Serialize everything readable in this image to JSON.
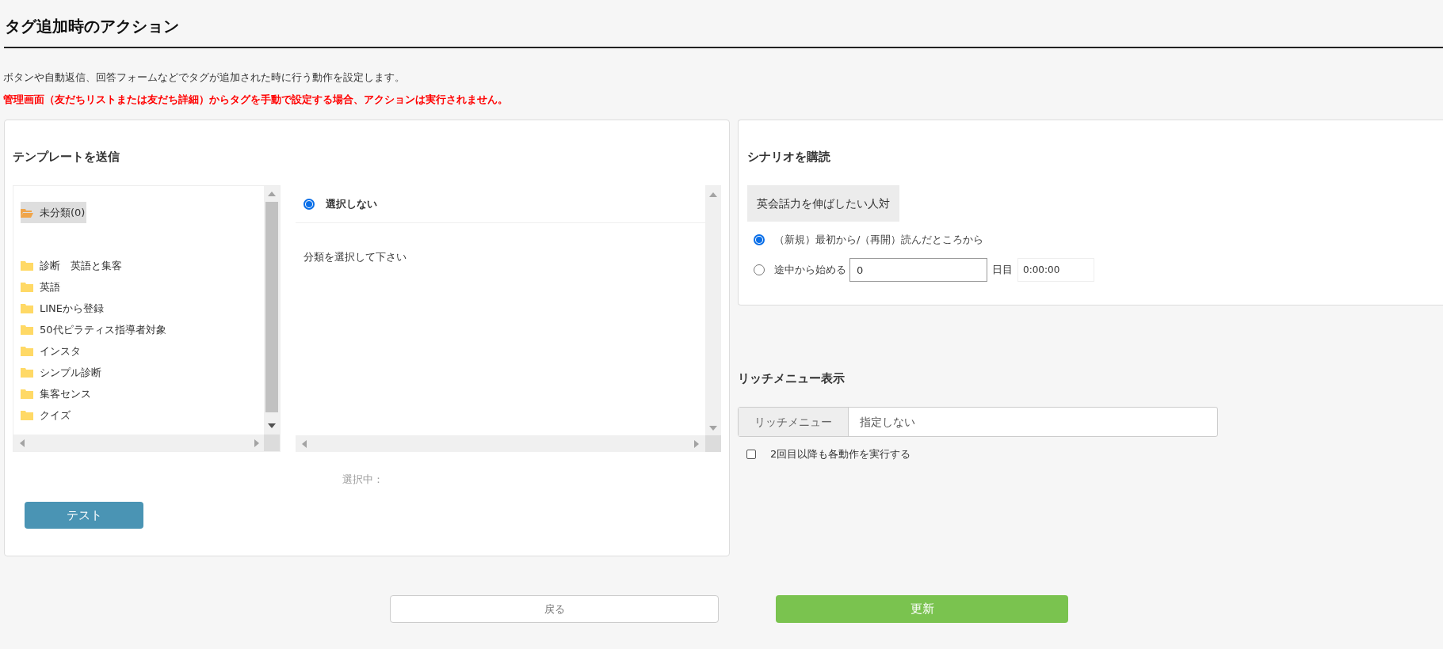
{
  "page_title": "タグ追加時のアクション",
  "description": "ボタンや自動返信、回答フォームなどでタグが追加された時に行う動作を設定します。",
  "warning": "管理画面（友だちリストまたは友だち詳細）からタグを手動で設定する場合、アクションは実行されません。",
  "template_section": {
    "heading": "テンプレートを送信",
    "folders": [
      {
        "name": "未分類(0)",
        "selected": true
      },
      {
        "name": "診断　英語と集客",
        "selected": false
      },
      {
        "name": "英語",
        "selected": false
      },
      {
        "name": "LINEから登録",
        "selected": false
      },
      {
        "name": "50代ピラティス指導者対象",
        "selected": false
      },
      {
        "name": "インスタ",
        "selected": false
      },
      {
        "name": "シンプル診断",
        "selected": false
      },
      {
        "name": "集客センス",
        "selected": false
      },
      {
        "name": "クイズ",
        "selected": false
      }
    ],
    "option": {
      "label": "選択しない",
      "selected": true
    },
    "hint": "分類を選択して下さい",
    "selected_label": "選択中：",
    "test_button": "テスト"
  },
  "scenario_section": {
    "heading": "シナリオを購読",
    "scenario_name": "英会話力を伸ばしたい人対",
    "start_options": [
      {
        "kind": "plain",
        "label": "（新規）最初から/（再開）読んだところから",
        "selected": true
      },
      {
        "kind": "day",
        "label": "途中から始める",
        "selected": false,
        "day_value": "0",
        "day_unit": "日目",
        "time_value": "0:00:00"
      }
    ]
  },
  "rich_menu_section": {
    "heading": "リッチメニュー表示",
    "addon_label": "リッチメニュー",
    "value": "指定しない",
    "repeat_checkbox": {
      "label": "2回目以降も各動作を実行する",
      "checked": false
    }
  },
  "buttons": [
    {
      "kind": "secondary",
      "label": "戻る"
    },
    {
      "kind": "primary",
      "label": "更新"
    }
  ]
}
